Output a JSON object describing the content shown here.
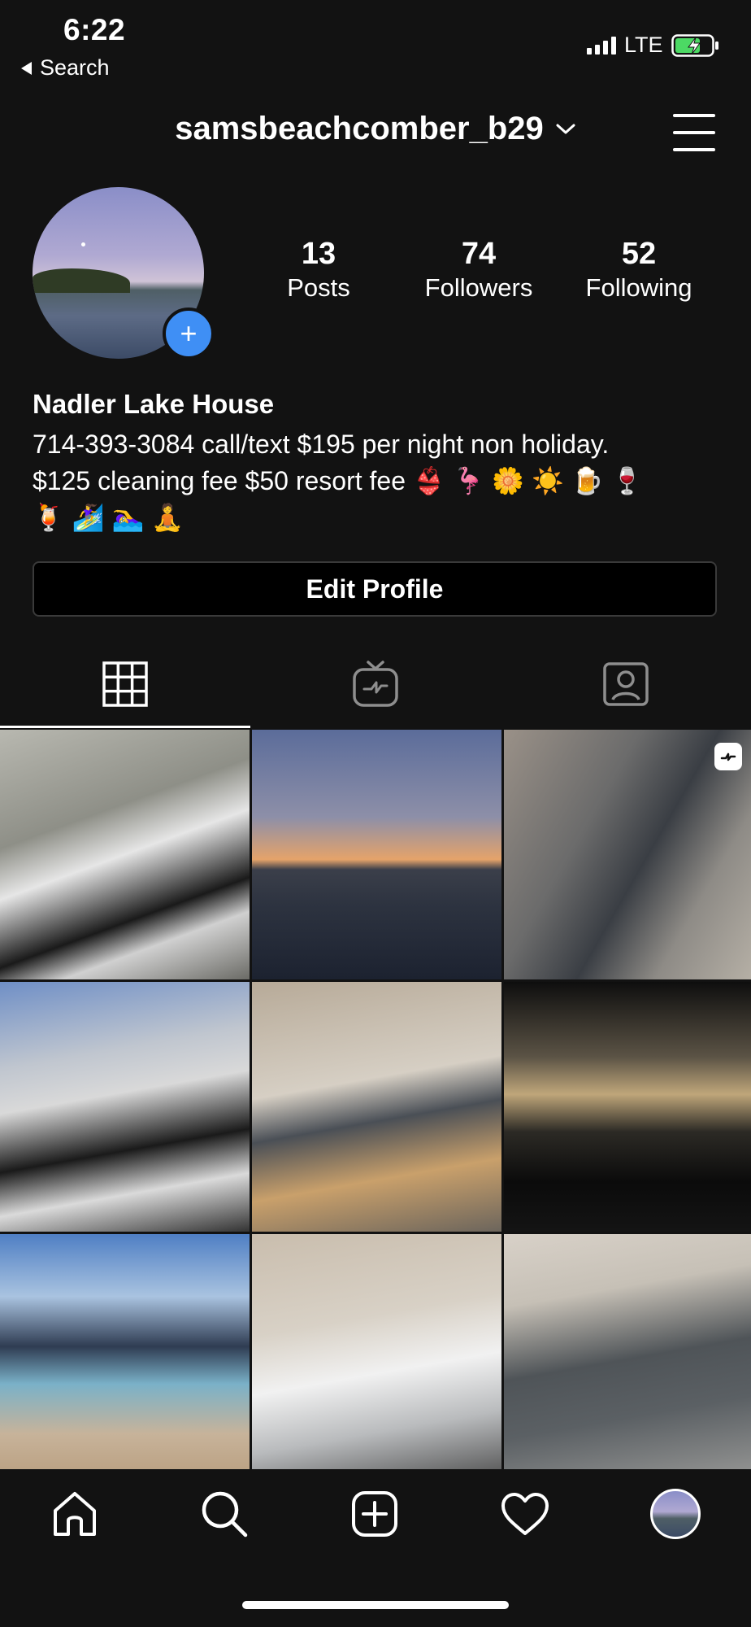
{
  "status_bar": {
    "time": "6:22",
    "back_label": "Search",
    "network": "LTE"
  },
  "header": {
    "username": "samsbeachcomber_b29"
  },
  "stats": [
    {
      "value": "13",
      "label": "Posts"
    },
    {
      "value": "74",
      "label": "Followers"
    },
    {
      "value": "52",
      "label": "Following"
    }
  ],
  "bio": {
    "name": "Nadler Lake House",
    "line1": "714-393-3084 call/text $195 per night non holiday.",
    "line2": "$125 cleaning fee $50 resort fee 👙 🦩 🌼 ☀️ 🍺 🍷",
    "line3": "🍹 🏄‍♀️ 🏊‍♀️ 🧘"
  },
  "edit_profile_label": "Edit Profile",
  "tabs": [
    {
      "icon": "grid-icon",
      "active": true
    },
    {
      "icon": "igtv-icon",
      "active": false
    },
    {
      "icon": "tagged-icon",
      "active": false
    }
  ],
  "colors": {
    "background": "#121212",
    "accent_blue": "#3f8ff5",
    "text": "#ffffff"
  },
  "bottom_nav": [
    "home-icon",
    "search-icon",
    "new-post-icon",
    "activity-icon",
    "profile-avatar"
  ]
}
